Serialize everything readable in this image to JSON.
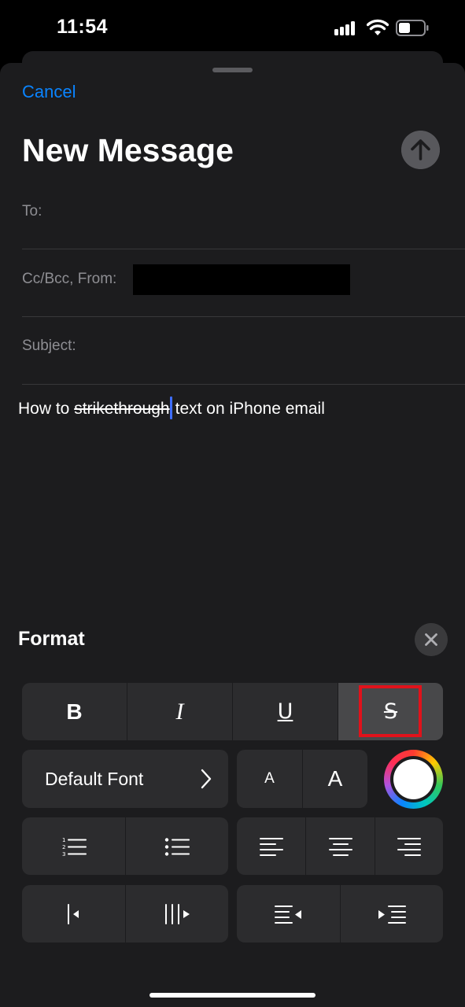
{
  "status_bar": {
    "time": "11:54",
    "battery_level": 0.45
  },
  "compose": {
    "cancel_label": "Cancel",
    "title": "New Message",
    "to_label": "To:",
    "ccbcc_label": "Cc/Bcc, From:",
    "subject_label": "Subject:",
    "body": {
      "before": "How to ",
      "strike": "strikethrough",
      "after": "text on iPhone email"
    }
  },
  "format": {
    "title": "Format",
    "style_buttons": [
      "B",
      "I",
      "U",
      "S"
    ],
    "active_style": "strikethrough",
    "font_label": "Default Font",
    "size_small": "A",
    "size_large": "A"
  },
  "colors": {
    "accent": "#0a84ff",
    "highlight": "#e0121b",
    "cursor": "#3e6dff"
  }
}
